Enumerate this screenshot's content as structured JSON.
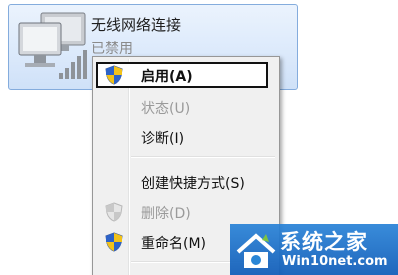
{
  "adapter": {
    "name": "无线网络连接",
    "status": "已禁用",
    "icon": "wireless-network-adapter-icon"
  },
  "menu": {
    "items": [
      {
        "label": "启用(A)",
        "icon": "uac-shield-icon",
        "bold": true,
        "focused": true,
        "disabled": false
      },
      {
        "label": "状态(U)",
        "disabled": true
      },
      {
        "label": "诊断(I)",
        "disabled": false
      },
      {
        "label": "创建快捷方式(S)",
        "disabled": false
      },
      {
        "label": "删除(D)",
        "icon": "uac-shield-icon",
        "disabled": true
      },
      {
        "label": "重命名(M)",
        "icon": "uac-shield-icon",
        "disabled": false
      }
    ]
  },
  "watermark": {
    "title": "系统之家",
    "url": "Win10net.com"
  },
  "colors": {
    "selection_border": "#84acdd",
    "menu_background": "#f0f0f0",
    "watermark_blue": "#1f78c8"
  }
}
